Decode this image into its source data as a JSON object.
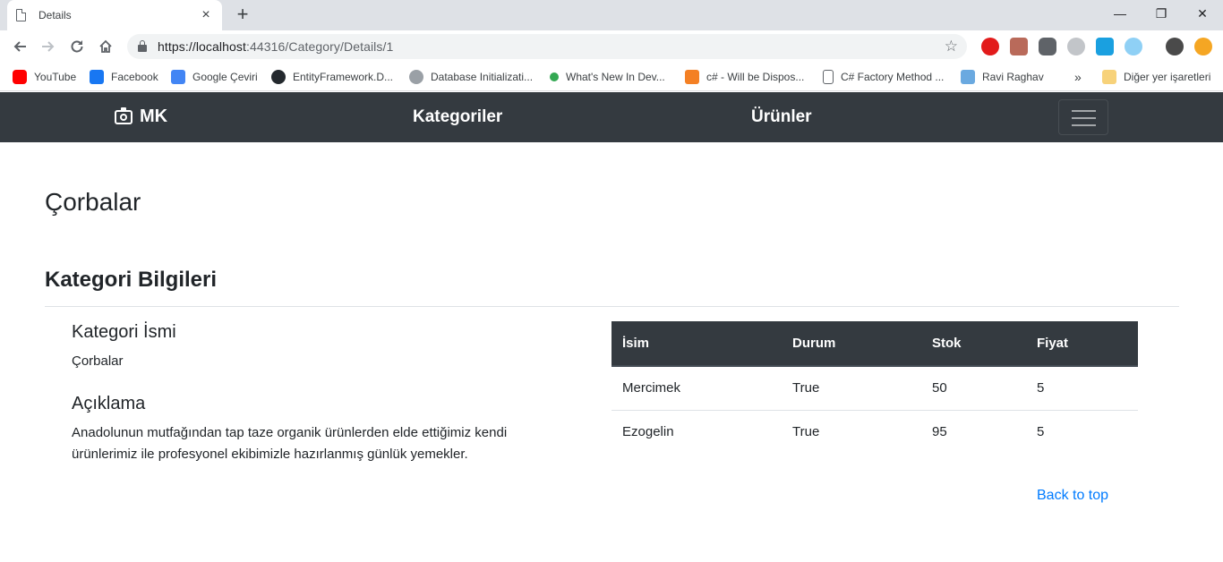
{
  "browser": {
    "tab_title": "Details",
    "tab_close": "×",
    "new_tab": "+",
    "window_controls": {
      "minimize": "—",
      "restore": "❐",
      "close": "✕"
    },
    "url_host": "https://localhost",
    "url_rest": ":44316/Category/Details/1",
    "bookmark_overflow": "»",
    "bookmarks": [
      {
        "label": "YouTube",
        "icon": "youtube-icon",
        "color": "#ff0000"
      },
      {
        "label": "Facebook",
        "icon": "facebook-icon",
        "color": "#1877f2"
      },
      {
        "label": "Google Çeviri",
        "icon": "google-translate-icon",
        "color": "#4285f4"
      },
      {
        "label": "EntityFramework.D...",
        "icon": "github-icon",
        "color": "#24292e"
      },
      {
        "label": "Database Initializati...",
        "icon": "site-icon",
        "color": "#5f6368"
      },
      {
        "label": "What's New In Dev...",
        "icon": "site-icon",
        "color": "#34a853"
      },
      {
        "label": "c# - Will be Dispos...",
        "icon": "stackoverflow-icon",
        "color": "#f48024"
      },
      {
        "label": "C# Factory Method ...",
        "icon": "page-icon",
        "color": "#5f6368"
      },
      {
        "label": "Ravi Raghav",
        "icon": "site-icon",
        "color": "#6aa9e0"
      },
      {
        "label": "Diğer yer işaretleri",
        "icon": "folder-icon",
        "color": "#f7d27a"
      }
    ]
  },
  "navbar": {
    "brand": "MK",
    "links": [
      "Kategoriler",
      "Ürünler"
    ]
  },
  "page": {
    "title": "Çorbalar",
    "section_title": "Kategori Bilgileri",
    "name_label": "Kategori İsmi",
    "name_value": "Çorbalar",
    "desc_label": "Açıklama",
    "desc_value": "Anadolunun mutfağından tap taze organik ürünlerden elde ettiğimiz kendi ürünlerimiz ile profesyonel ekibimizle hazırlanmış günlük yemekler."
  },
  "products_table": {
    "headers": [
      "İsim",
      "Durum",
      "Stok",
      "Fiyat"
    ],
    "rows": [
      [
        "Mercimek",
        "True",
        "50",
        "5"
      ],
      [
        "Ezogelin",
        "True",
        "95",
        "5"
      ]
    ]
  },
  "back_to_top": "Back to top"
}
